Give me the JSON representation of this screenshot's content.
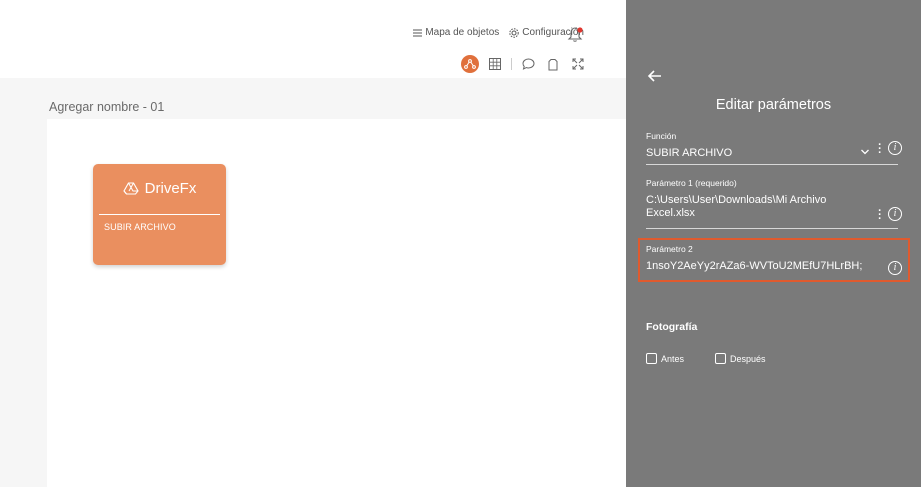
{
  "header": {
    "map_label": "Mapa de objetos",
    "config_label": "Configuración"
  },
  "toolbar": {
    "tools": [
      "flow-icon",
      "grid-icon",
      "comment-icon",
      "clipboard-icon",
      "expand-icon"
    ],
    "accent_color": "#e0703c"
  },
  "canvas": {
    "title": "Agregar nombre - 01",
    "card": {
      "title": "DriveFx",
      "subtitle": "SUBIR ARCHIVO",
      "color": "#ea8f5f"
    }
  },
  "panel": {
    "title": "Editar parámetros",
    "funcion": {
      "label": "Función",
      "value": "SUBIR ARCHIVO"
    },
    "param1": {
      "label": "Parámetro 1 (requerido)",
      "value": "C:\\Users\\User\\Downloads\\Mi Archivo Excel.xlsx"
    },
    "param2": {
      "label": "Parámetro 2",
      "value": "1nsoY2AeYy2rAZa6-WVToU2MEfU7HLrBH;"
    },
    "fotografia": {
      "label": "Fotografía",
      "antes": "Antes",
      "despues": "Después"
    },
    "highlight_color": "#e05a2e"
  }
}
